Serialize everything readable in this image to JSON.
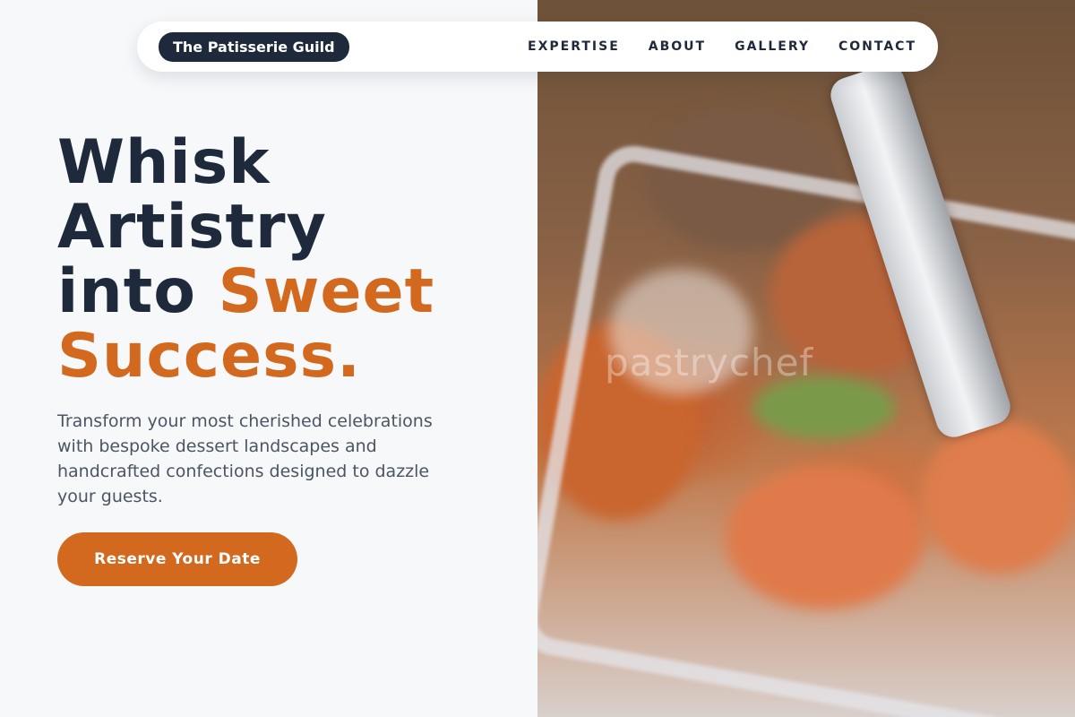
{
  "brand": {
    "name": "The Patisserie Guild"
  },
  "nav": {
    "items": [
      {
        "label": "EXPERTISE"
      },
      {
        "label": "ABOUT"
      },
      {
        "label": "GALLERY"
      },
      {
        "label": "CONTACT"
      }
    ]
  },
  "hero": {
    "headline_line1": "Whisk",
    "headline_line2": "Artistry",
    "headline_line3_prefix": "into ",
    "headline_line3_accent": "Sweet",
    "headline_line4_accent": "Success.",
    "description": "Transform your most cherished celebrations with bespoke dessert landscapes and handcrafted confections designed to dazzle your guests.",
    "cta_label": "Reserve Your Date"
  },
  "image": {
    "watermark": "pastrychef"
  },
  "colors": {
    "accent": "#d2691e",
    "navy": "#1e293b",
    "background": "#f7f8fa",
    "body_text": "#4b5563"
  }
}
